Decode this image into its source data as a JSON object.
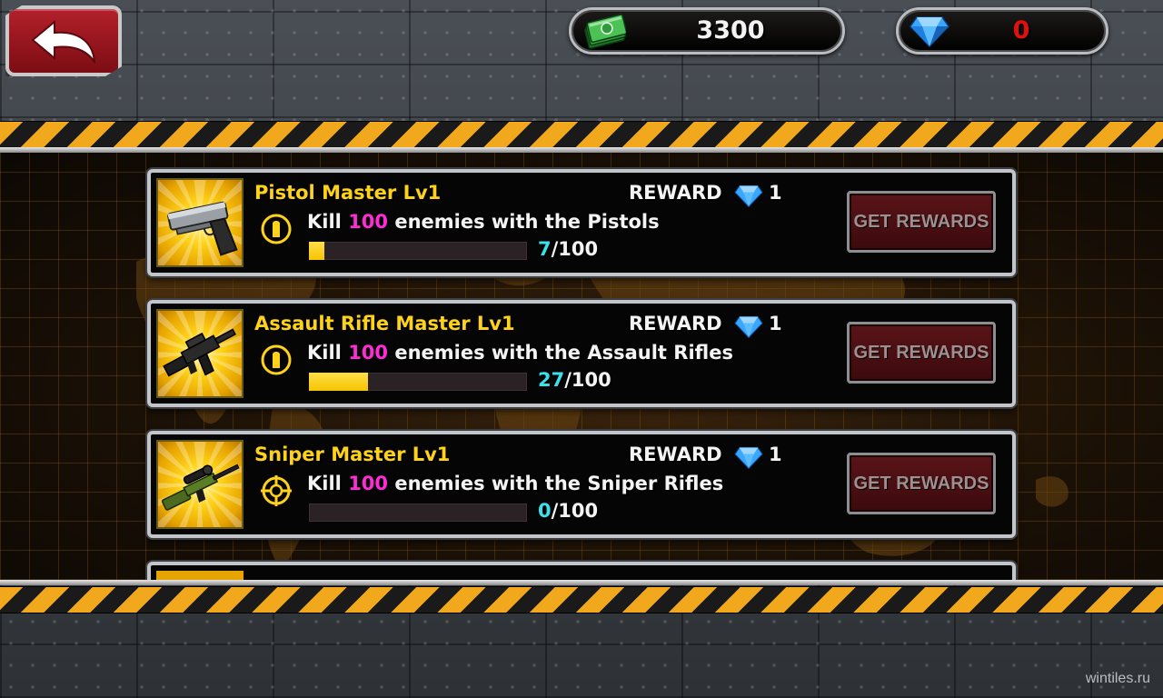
{
  "header": {
    "cash": "3300",
    "gems": "0"
  },
  "missions": [
    {
      "title": "Pistol Master Lv1",
      "reward_label": "REWARD",
      "reward_count": "1",
      "desc_pre": "Kill ",
      "desc_num": "100",
      "desc_post": " enemies with the Pistols",
      "progress_current": "7",
      "progress_total": "/100",
      "progress_fraction": 0.07,
      "button_label": "GET REWARDS",
      "weapon": "pistol-icon",
      "type_icon": "bullet-icon"
    },
    {
      "title": "Assault Rifle Master Lv1",
      "reward_label": "REWARD",
      "reward_count": "1",
      "desc_pre": "Kill ",
      "desc_num": "100",
      "desc_post": " enemies with the Assault Rifles",
      "progress_current": "27",
      "progress_total": "/100",
      "progress_fraction": 0.27,
      "button_label": "GET REWARDS",
      "weapon": "assault-rifle-icon",
      "type_icon": "bullet-icon"
    },
    {
      "title": "Sniper Master Lv1",
      "reward_label": "REWARD",
      "reward_count": "1",
      "desc_pre": "Kill ",
      "desc_num": "100",
      "desc_post": " enemies with the Sniper Rifles",
      "progress_current": "0",
      "progress_total": "/100",
      "progress_fraction": 0.0,
      "button_label": "GET REWARDS",
      "weapon": "sniper-rifle-icon",
      "type_icon": "crosshair-icon"
    }
  ],
  "watermark": "wintiles.ru",
  "colors": {
    "title_yellow": "#ffd21a",
    "kill_count_magenta": "#ff2cd6",
    "progress_cyan": "#3ae0ea",
    "gem_count_red": "#e01010",
    "hazard_orange": "#f2a81c"
  }
}
